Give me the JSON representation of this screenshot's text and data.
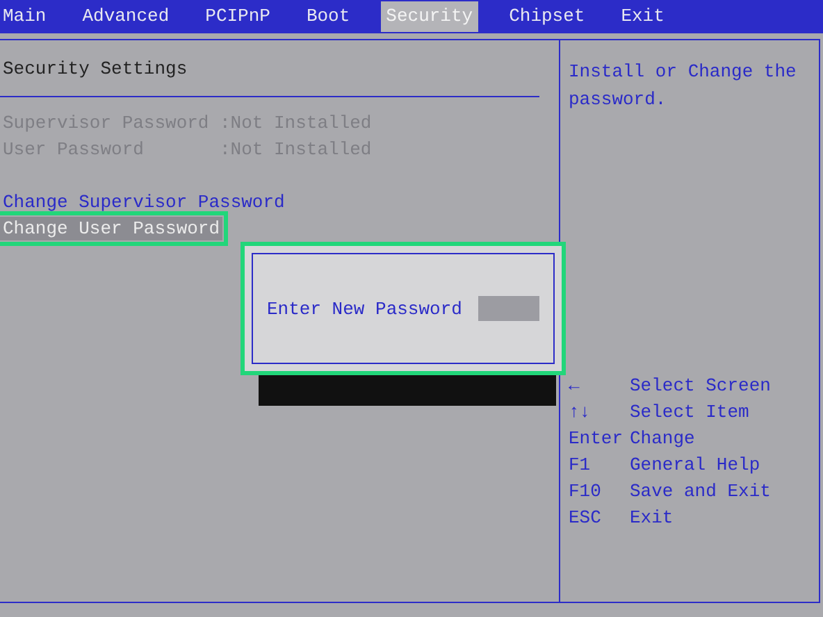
{
  "menu": [
    {
      "label": "Main",
      "selected": false
    },
    {
      "label": "Advanced",
      "selected": false
    },
    {
      "label": "PCIPnP",
      "selected": false
    },
    {
      "label": "Boot",
      "selected": false
    },
    {
      "label": "Security",
      "selected": true
    },
    {
      "label": "Chipset",
      "selected": false
    },
    {
      "label": "Exit",
      "selected": false
    }
  ],
  "section_title": "Security Settings",
  "status": [
    {
      "label": "Supervisor Password",
      "value": ":Not Installed"
    },
    {
      "label": "User Password",
      "value": ":Not Installed"
    }
  ],
  "items": [
    {
      "label": "Change Supervisor Password",
      "selected": false,
      "highlighted": false
    },
    {
      "label": "Change User Password",
      "selected": true,
      "highlighted": true
    }
  ],
  "help_text": "Install or Change the password.",
  "keys": [
    {
      "key": "←",
      "action": "Select Screen"
    },
    {
      "key": "↑↓",
      "action": "Select Item"
    },
    {
      "key": "Enter",
      "action": "Change"
    },
    {
      "key": "F1",
      "action": "General Help"
    },
    {
      "key": "F10",
      "action": "Save and Exit"
    },
    {
      "key": "ESC",
      "action": "Exit"
    }
  ],
  "dialog": {
    "label": "Enter New Password",
    "highlighted": true
  }
}
